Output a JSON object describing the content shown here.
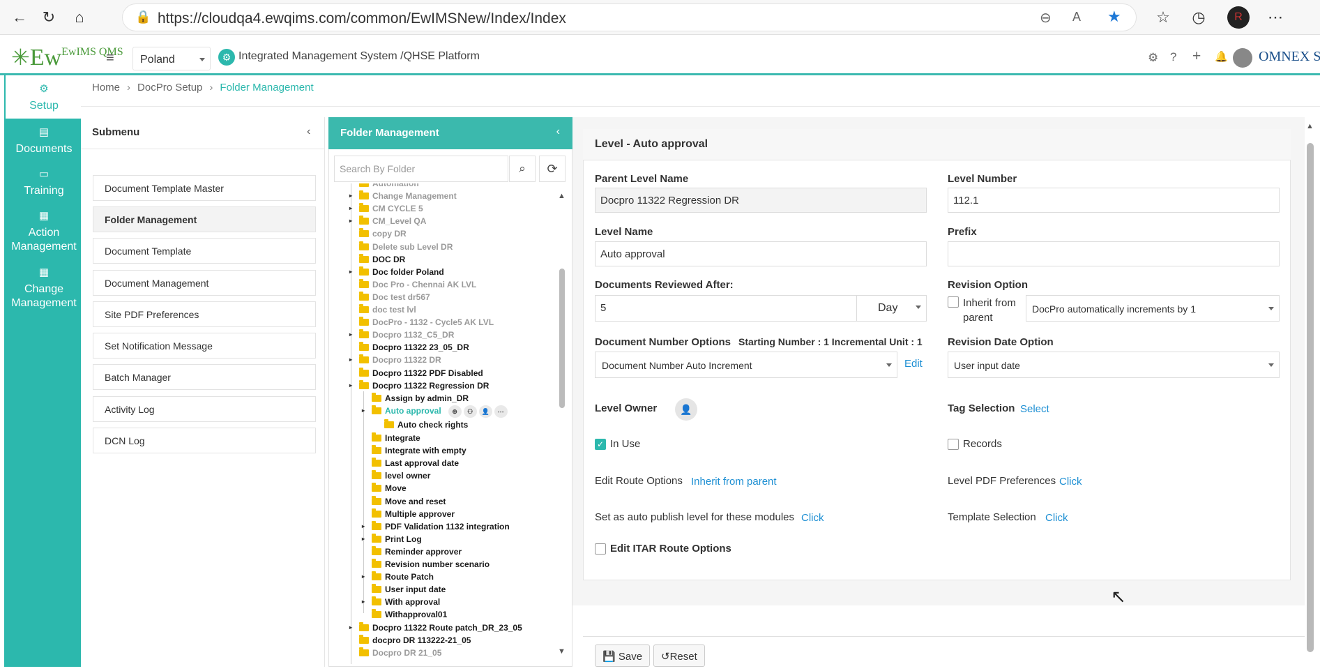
{
  "browser": {
    "url": "https://cloudqa4.ewqims.com/common/EwIMSNew/Index/Index"
  },
  "header": {
    "logo_text": "EwIMS QMS",
    "country": "Poland",
    "platform_title": "Integrated Management System /QHSE Platform",
    "brand_right": "OMNEX SYSTEMS"
  },
  "leftnav": {
    "items": [
      {
        "label": "Setup",
        "icon": "gears-icon"
      },
      {
        "label": "Documents",
        "icon": "documents-icon"
      },
      {
        "label": "Training",
        "icon": "training-icon"
      },
      {
        "label": "Action Management",
        "icon": "action-icon"
      },
      {
        "label": "Change Management",
        "icon": "change-icon"
      }
    ]
  },
  "breadcrumb": {
    "home": "Home",
    "setup": "DocPro Setup",
    "current": "Folder Management"
  },
  "submenu": {
    "title": "Submenu",
    "items": [
      "Document Template Master",
      "Folder Management",
      "Document Template",
      "Document Management",
      "Site PDF Preferences",
      "Set Notification Message",
      "Batch Manager",
      "Activity Log",
      "DCN Log"
    ]
  },
  "folder_panel": {
    "title": "Folder Management",
    "search_placeholder": "Search By Folder",
    "tree": [
      "Automation",
      "Change Management",
      "CM CYCLE 5",
      "CM_Level QA",
      "copy DR",
      "Delete sub Level DR",
      "DOC DR",
      "Doc folder Poland",
      "Doc Pro - Chennai AK LVL",
      "Doc test dr567",
      "doc test lvl",
      "DocPro - 1132 - Cycle5 AK LVL",
      "Docpro 1132_C5_DR",
      "Docpro 11322 23_05_DR",
      "Docpro 11322 DR",
      "Docpro 11322 PDF Disabled",
      "Docpro 11322 Regression DR",
      "Assign by admin_DR",
      "Auto approval",
      "Auto check rights",
      "Integrate",
      "Integrate with empty",
      "Last approval date",
      "level owner",
      "Move",
      "Move and reset",
      "Multiple approver",
      "PDF Validation 1132 integration",
      "Print Log",
      "Reminder approver",
      "Revision number scenario",
      "Route Patch",
      "User input date",
      "With approval",
      "Withapproval01",
      "Docpro 11322 Route patch_DR_23_05",
      "docpro DR 113222-21_05",
      "Docpro DR 21_05"
    ]
  },
  "form": {
    "title": "Level - Auto approval",
    "parent_level_name_label": "Parent Level Name",
    "parent_level_name": "Docpro 11322 Regression DR",
    "level_number_label": "Level Number",
    "level_number": "112.1",
    "level_name_label": "Level Name",
    "level_name": "Auto approval",
    "prefix_label": "Prefix",
    "prefix": "",
    "docs_reviewed_label": "Documents Reviewed After:",
    "docs_reviewed_value": "5",
    "docs_reviewed_unit": "Day",
    "revision_option_label": "Revision Option",
    "inherit_from_parent_label": "Inherit from parent",
    "revision_option_value": "DocPro automatically increments by 1",
    "doc_number_options_label": "Document Number Options",
    "starting_number_text": "Starting Number : 1 Incremental Unit : 1",
    "doc_number_option_value": "Document Number Auto Increment",
    "edit_link": "Edit",
    "revision_date_option_label": "Revision Date Option",
    "revision_date_option_value": "User input date",
    "level_owner_label": "Level Owner",
    "tag_selection_label": "Tag Selection",
    "tag_select_link": "Select",
    "in_use_label": "In Use",
    "records_label": "Records",
    "edit_route_options_label": "Edit Route Options",
    "inherit_from_parent_link": "Inherit from parent",
    "level_pdf_prefs_label": "Level PDF Preferences",
    "click_link": "Click",
    "auto_publish_label": "Set as auto publish level for these modules",
    "template_selection_label": "Template Selection",
    "edit_itar_label": "Edit ITAR Route Options",
    "save_label": "Save",
    "reset_label": "Reset"
  }
}
